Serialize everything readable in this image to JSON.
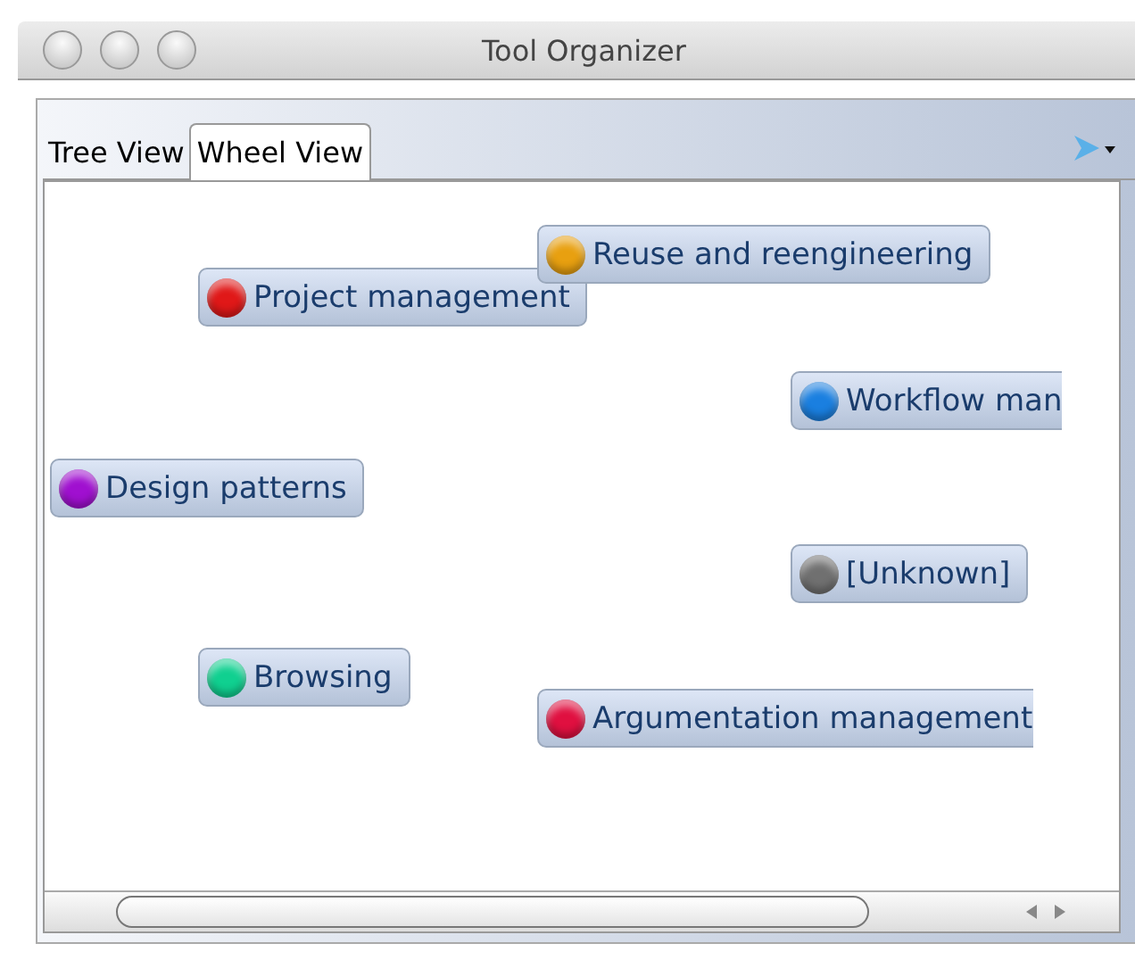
{
  "window": {
    "title": "Tool Organizer"
  },
  "tabs": [
    {
      "label": "Tree View",
      "selected": false
    },
    {
      "label": "Wheel View",
      "selected": true
    }
  ],
  "nodes": [
    {
      "label": "Project management",
      "color": "#e01818"
    },
    {
      "label": "Reuse and reengineering",
      "color": "#e8a010"
    },
    {
      "label": "Workflow man",
      "color": "#1a7fe0"
    },
    {
      "label": "Design patterns",
      "color": "#a010d0"
    },
    {
      "label": "[Unknown]",
      "color": "#707070"
    },
    {
      "label": "Browsing",
      "color": "#10d090"
    },
    {
      "label": "Argumentation management",
      "color": "#e01040"
    }
  ]
}
